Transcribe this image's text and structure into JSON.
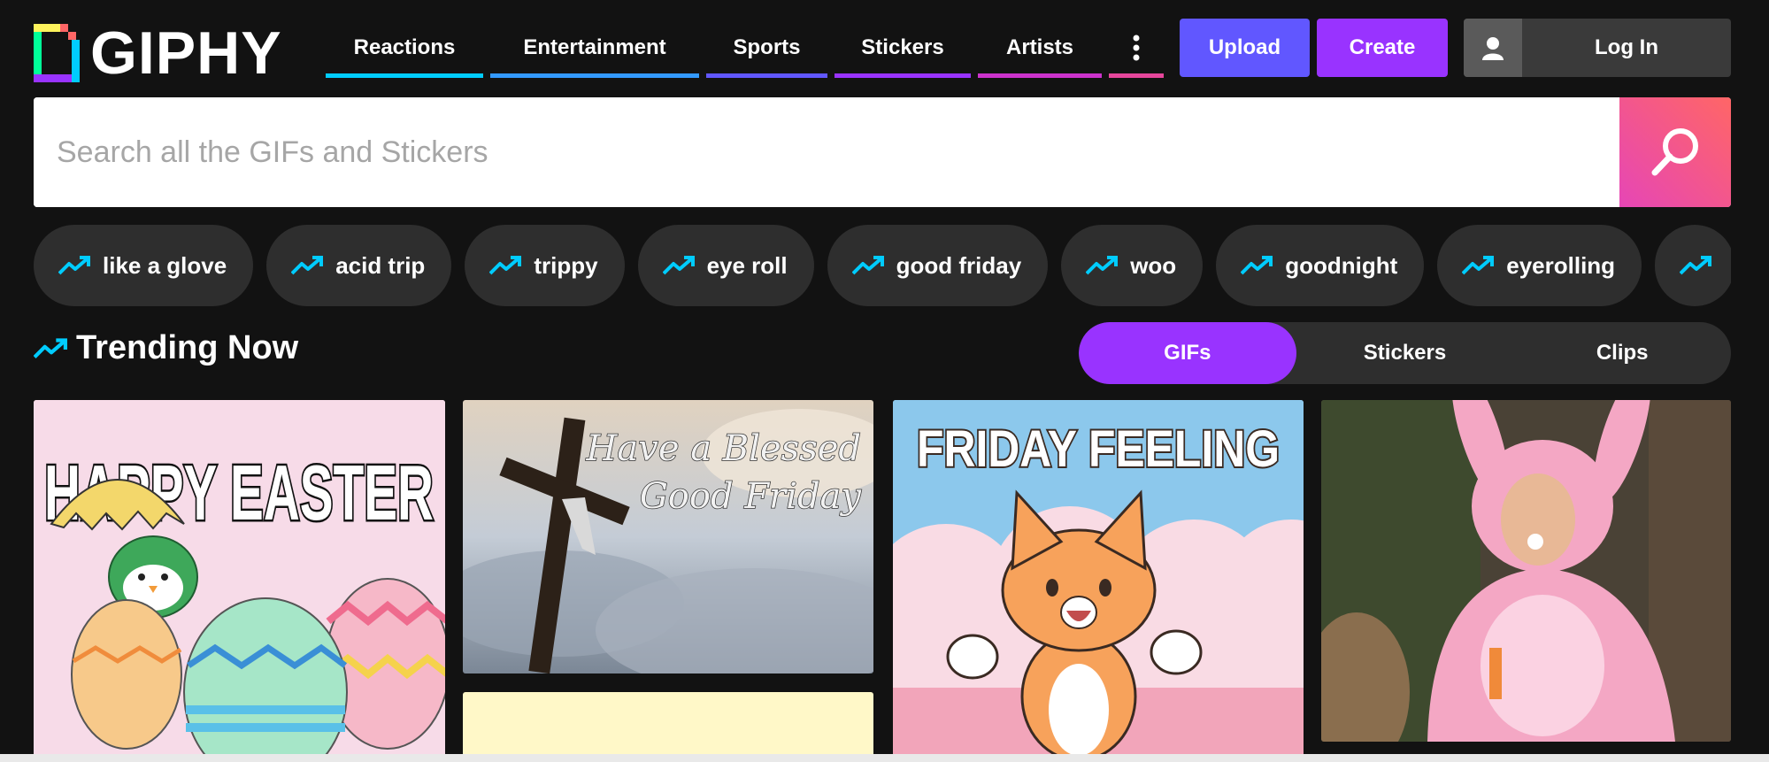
{
  "brand": {
    "name": "GIPHY"
  },
  "nav": {
    "items": [
      {
        "label": "Reactions",
        "color": "#00ccff"
      },
      {
        "label": "Entertainment",
        "color": "#3399ff"
      },
      {
        "label": "Sports",
        "color": "#6157ff"
      },
      {
        "label": "Stickers",
        "color": "#9933ff"
      },
      {
        "label": "Artists",
        "color": "#cc33cc"
      }
    ],
    "more_icon": "more-vertical-icon",
    "more_color": "#e6469b"
  },
  "actions": {
    "upload": "Upload",
    "create": "Create",
    "login": "Log In"
  },
  "search": {
    "placeholder": "Search all the GIFs and Stickers",
    "value": ""
  },
  "trending_pills": [
    "like a glove",
    "acid trip",
    "trippy",
    "eye roll",
    "good friday",
    "woo",
    "goodnight",
    "eyerolling"
  ],
  "section": {
    "title": "Trending Now"
  },
  "tabs": {
    "items": [
      "GIFs",
      "Stickers",
      "Clips"
    ],
    "active": "GIFs"
  },
  "gifs": {
    "easter": "HAPPY EASTER",
    "goodfriday_line1": "Have a Blessed",
    "goodfriday_line2": "Good Friday",
    "friday": "FRIDAY FEELING"
  },
  "colors": {
    "accent_purple": "#9933ff",
    "upload_blue": "#6157ff",
    "trend_cyan": "#00ccff",
    "search_gradient_start": "#e646b6",
    "search_gradient_end": "#ff6666"
  }
}
